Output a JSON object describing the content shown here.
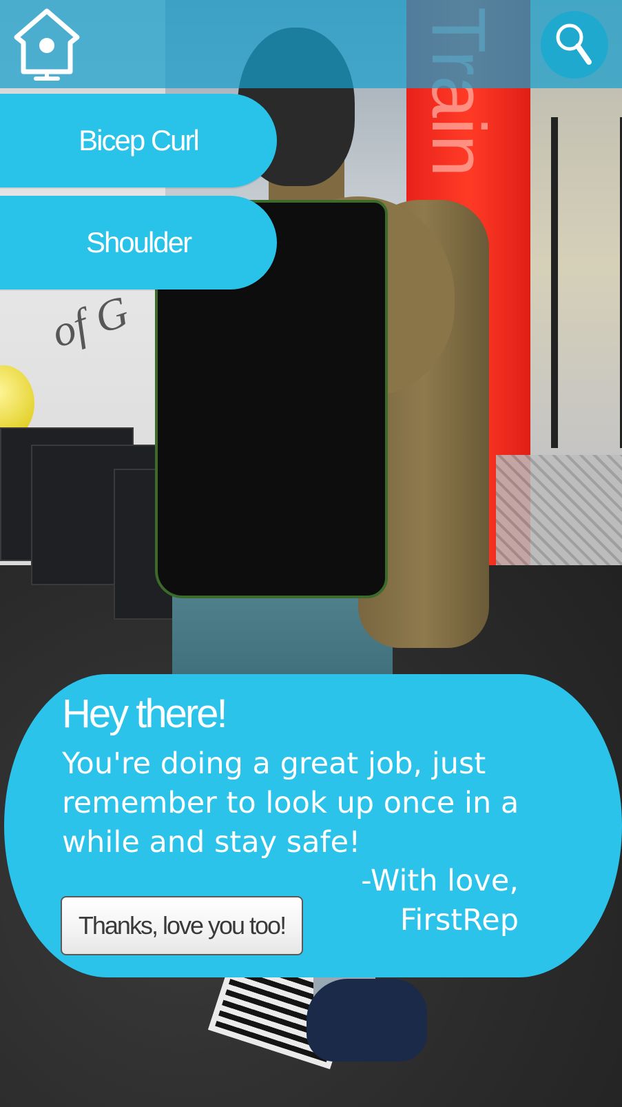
{
  "scene": {
    "background": "ar-camera-gym-scene",
    "avatar": "3d-trainer-avatar",
    "marker": "qr-code-marker",
    "wall_lettering": "Train"
  },
  "top_bar": {
    "home_icon": "birdhouse-home-icon",
    "search_icon": "magnifier-search-icon"
  },
  "exercises": {
    "bicep_label": "Bicep Curl",
    "shoulder_label": "Shoulder"
  },
  "message": {
    "title": "Hey there!",
    "body": "You're doing a great job, just remember to look up once in a while and stay safe!",
    "sign_line1": "-With love,",
    "sign_line2": "FirstRep",
    "ack_label": "Thanks, love you too!"
  },
  "colors": {
    "accent": "#29c2e8",
    "top_bar": "#18a0cd",
    "text_on_accent": "#ffffff"
  }
}
